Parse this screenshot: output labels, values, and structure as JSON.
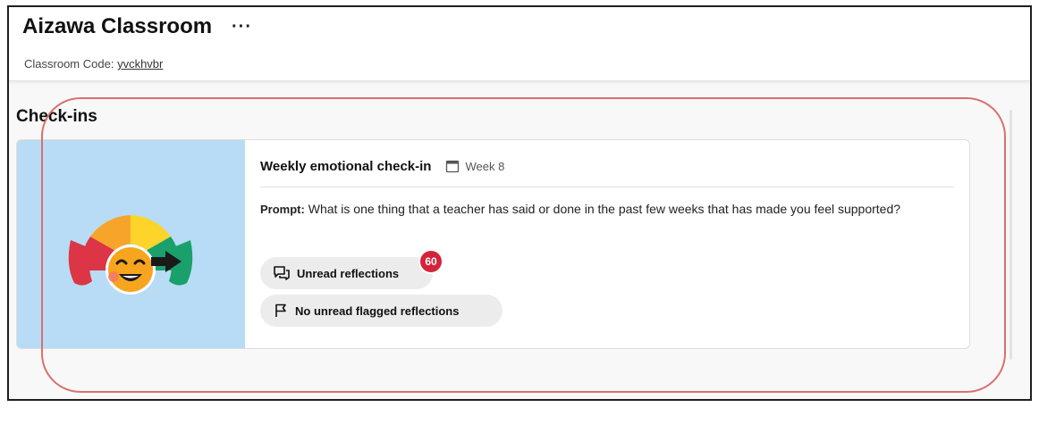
{
  "header": {
    "title": "Aizawa Classroom",
    "more_label": "···",
    "code_label": "Classroom Code:",
    "code_value": "yvckhvbr"
  },
  "section": {
    "title": "Check-ins"
  },
  "checkin": {
    "title": "Weekly emotional check-in",
    "week": "Week 8",
    "prompt_label": "Prompt:",
    "prompt_text": "What is one thing that a teacher has said or done in the past few weeks that has made you feel supported?",
    "unread_label": "Unread reflections",
    "unread_count": "60",
    "flagged_label": "No unread flagged reflections",
    "image_icon": "emotion-meter-icon"
  },
  "colors": {
    "image_bg": "#b8dcf5",
    "badge": "#d3243b",
    "highlight": "#d9706e",
    "pill_bg": "#ececec"
  }
}
